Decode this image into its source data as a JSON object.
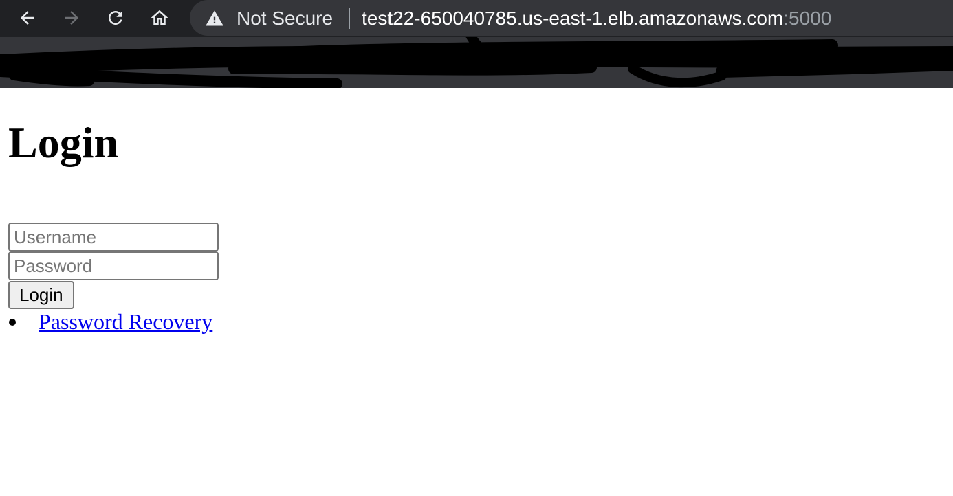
{
  "browser": {
    "security_label": "Not Secure",
    "url_host": "test22-650040785.us-east-1.elb.amazonaws.com",
    "url_port": ":5000",
    "icons": [
      "back-arrow-icon",
      "forward-arrow-icon",
      "reload-icon",
      "home-icon",
      "warning-icon"
    ],
    "colors": {
      "toolbar_bg": "#202124",
      "omnibox_bg": "#35363a",
      "text": "#e8eaed",
      "port_text": "#9aa0a6"
    }
  },
  "page": {
    "title": "Login",
    "username_placeholder": "Username",
    "password_placeholder": "Password",
    "login_button_label": "Login",
    "links": [
      {
        "label": "Password Recovery"
      }
    ],
    "colors": {
      "link": "#0000ee",
      "button_bg": "#efefef"
    }
  }
}
